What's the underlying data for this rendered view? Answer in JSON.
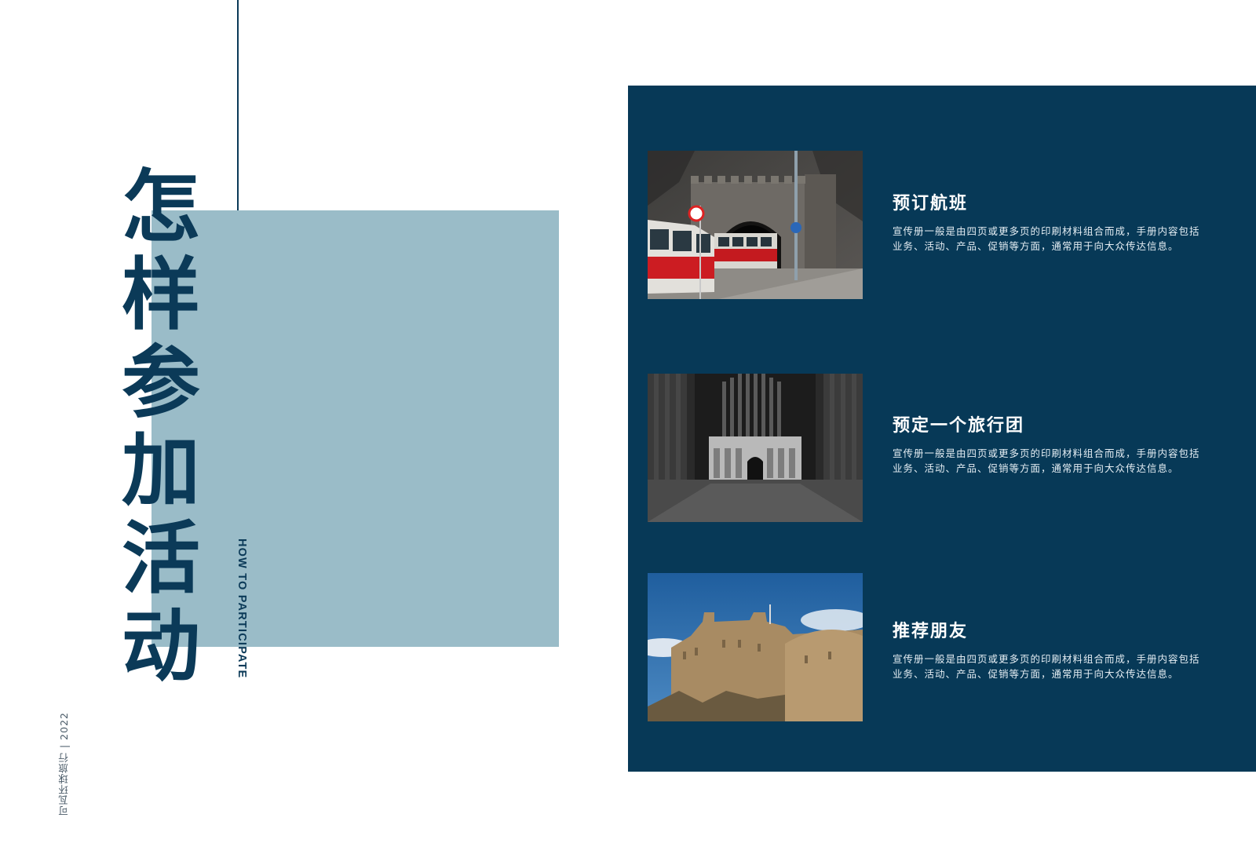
{
  "title": [
    "怎",
    "样",
    "参",
    "加",
    "活",
    "动"
  ],
  "subtitle": "HOW TO PARTICIPATE",
  "footer": "可瓦环球旅行 | 2022",
  "colors": {
    "navy": "#073957",
    "light_blue": "#9abcc8",
    "text_dark": "#0b3a58"
  },
  "items": [
    {
      "heading": "预订航班",
      "body": "宣传册一般是由四页或更多页的印刷材料组合而成，手册内容包括业务、活动、产品、促销等方面，通常用于向大众传达信息。",
      "photo": "tram-tunnel-photo"
    },
    {
      "heading": "预定一个旅行团",
      "body": "宣传册一般是由四页或更多页的印刷材料组合而成，手册内容包括业务、活动、产品、促销等方面，通常用于向大众传达信息。",
      "photo": "cathedral-interior-photo"
    },
    {
      "heading": "推荐朋友",
      "body": "宣传册一般是由四页或更多页的印刷材料组合而成，手册内容包括业务、活动、产品、促销等方面，通常用于向大众传达信息。",
      "photo": "castle-photo"
    }
  ]
}
